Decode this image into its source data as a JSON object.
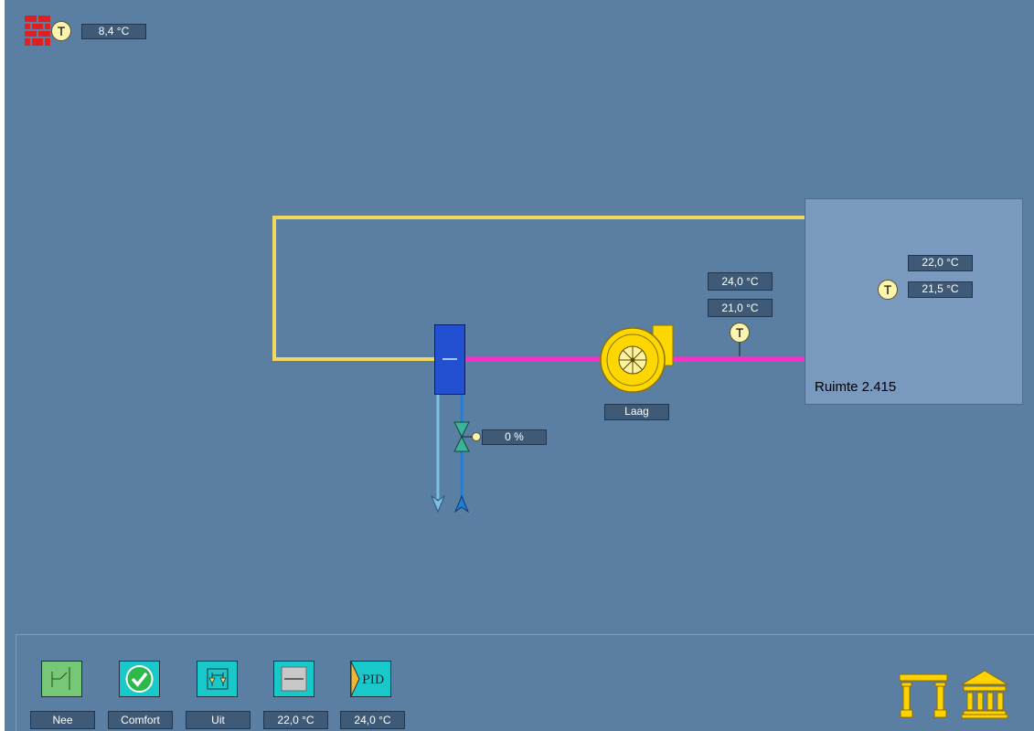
{
  "outside": {
    "temp": "8,4 °C",
    "sensor_letter": "T",
    "wall_icon": "brick-wall-icon"
  },
  "supply": {
    "setpoint": "24,0 °C",
    "temp": "21,0 °C",
    "sensor_letter": "T"
  },
  "fan": {
    "speed": "Laag",
    "icon": "fan-icon"
  },
  "valve": {
    "position": "0 %",
    "level": 0,
    "icon": "valve-icon"
  },
  "heat_exchanger": {
    "icon": "coil-icon"
  },
  "room": {
    "name": "Ruimte 2.415",
    "setpoint": "22,0 °C",
    "temp": "21,5 °C",
    "sensor_letter": "T"
  },
  "toolbar": {
    "items": [
      {
        "icon": "switch-icon",
        "label": "Nee",
        "color": "#76c776"
      },
      {
        "icon": "check-icon",
        "label": "Comfort",
        "color": "#19c9c9"
      },
      {
        "icon": "valve-mode-icon",
        "label": "Uit",
        "color": "#19c9c9"
      },
      {
        "icon": "setpoint-icon",
        "label": "22,0 °C",
        "color": "#19c9c9"
      },
      {
        "icon": "pid-icon",
        "label": "24,0 °C",
        "text": "PID",
        "color": "#19c9c9"
      }
    ]
  },
  "nav": {
    "left_icon": "columns-icon",
    "right_icon": "building-icon"
  },
  "colors": {
    "background": "#5a7fa3",
    "return_air": "#f0d860",
    "supply_air": "#ff2ec8",
    "coil": "#2350d0",
    "fan": "#ffd700",
    "water_return": "#7ec1e6",
    "water_supply": "#1e7fd8",
    "room_panel": "#7a99be"
  }
}
